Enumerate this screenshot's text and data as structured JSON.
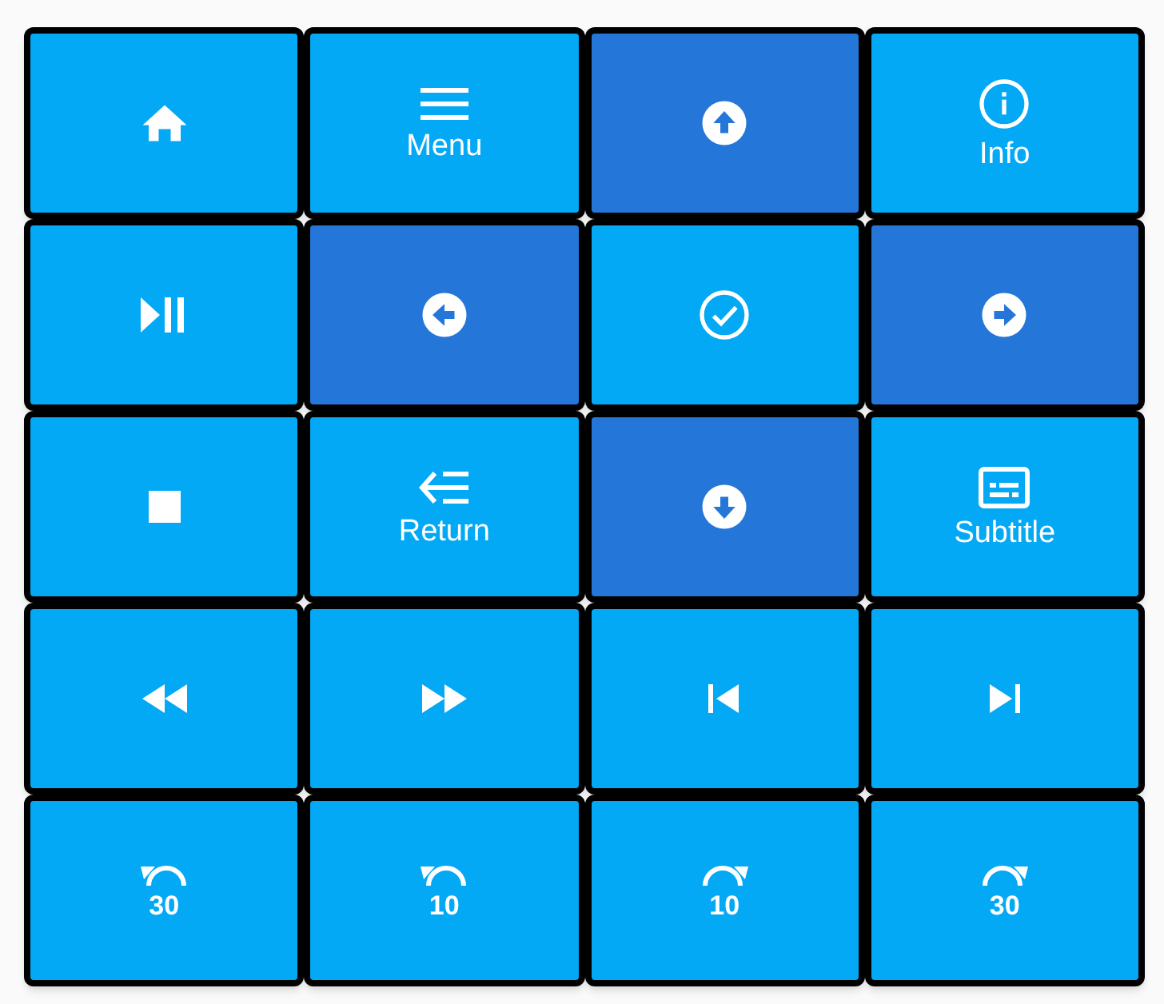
{
  "buttons": [
    {
      "kind": "home",
      "color": "#03a9f4"
    },
    {
      "kind": "menu",
      "label": "Menu",
      "color": "#03a9f4"
    },
    {
      "kind": "up",
      "color": "#2476d9"
    },
    {
      "kind": "info",
      "label": "Info",
      "color": "#03a9f4"
    },
    {
      "kind": "play_pause",
      "color": "#03a9f4"
    },
    {
      "kind": "left",
      "color": "#2476d9"
    },
    {
      "kind": "ok",
      "color": "#03a9f4"
    },
    {
      "kind": "right",
      "color": "#2476d9"
    },
    {
      "kind": "stop",
      "color": "#03a9f4"
    },
    {
      "kind": "return",
      "label": "Return",
      "color": "#03a9f4"
    },
    {
      "kind": "down",
      "color": "#2476d9"
    },
    {
      "kind": "subtitle",
      "label": "Subtitle",
      "color": "#03a9f4"
    },
    {
      "kind": "rewind",
      "color": "#03a9f4"
    },
    {
      "kind": "fast_forward",
      "color": "#03a9f4"
    },
    {
      "kind": "previous",
      "color": "#03a9f4"
    },
    {
      "kind": "next",
      "color": "#03a9f4"
    },
    {
      "kind": "replay",
      "number": "30",
      "color": "#03a9f4"
    },
    {
      "kind": "replay",
      "number": "10",
      "color": "#03a9f4"
    },
    {
      "kind": "forward",
      "number": "10",
      "color": "#03a9f4"
    },
    {
      "kind": "forward",
      "number": "30",
      "color": "#03a9f4"
    }
  ]
}
